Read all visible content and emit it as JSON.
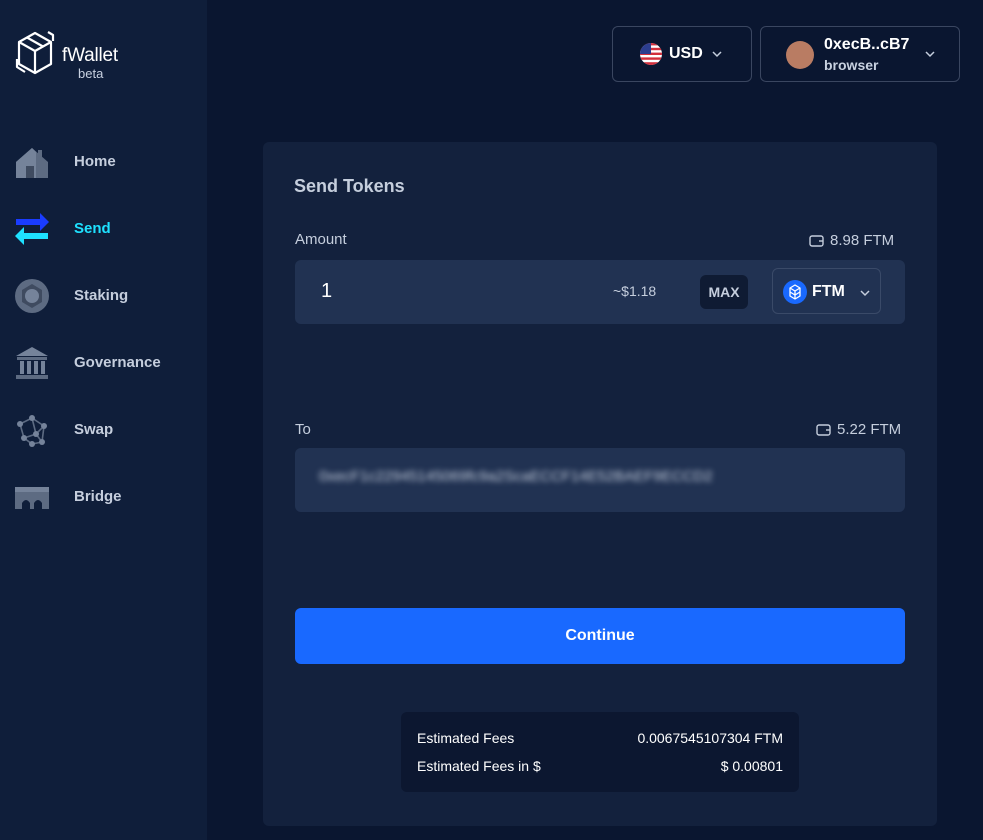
{
  "app": {
    "name": "fWallet",
    "tag": "beta",
    "logo_icon": "fantom-cube-icon"
  },
  "sidebar": {
    "items": [
      {
        "label": "Home",
        "icon": "home-icon",
        "active": false
      },
      {
        "label": "Send",
        "icon": "send-arrows-icon",
        "active": true
      },
      {
        "label": "Staking",
        "icon": "staking-icon",
        "active": false
      },
      {
        "label": "Governance",
        "icon": "governance-icon",
        "active": false
      },
      {
        "label": "Swap",
        "icon": "swap-icon",
        "active": false
      },
      {
        "label": "Bridge",
        "icon": "bridge-icon",
        "active": false
      }
    ]
  },
  "header": {
    "currency": {
      "label": "USD",
      "icon": "us-flag-icon"
    },
    "account": {
      "address": "0xecB..cB7",
      "wallet_type": "browser"
    }
  },
  "send": {
    "title": "Send Tokens",
    "amount": {
      "label": "Amount",
      "balance": "8.98 FTM",
      "value": "1",
      "usd_estimate": "~$1.18",
      "max_label": "MAX",
      "token": "FTM"
    },
    "to": {
      "label": "To",
      "balance": "5.22 FTM",
      "address": "0xecF1c22945145069fc9a2ScaECCF14E52BAEF9ECCD2"
    },
    "continue_label": "Continue",
    "fees": [
      {
        "label": "Estimated Fees",
        "value": "0.0067545107304 FTM"
      },
      {
        "label": "Estimated Fees in $",
        "value": "$ 0.00801"
      }
    ]
  },
  "colors": {
    "background": "#0a1630",
    "sidebar": "#0f1e3a",
    "card": "#13213d",
    "input": "#213252",
    "accent_active": "#1ee1ff",
    "primary_button": "#1969ff"
  }
}
